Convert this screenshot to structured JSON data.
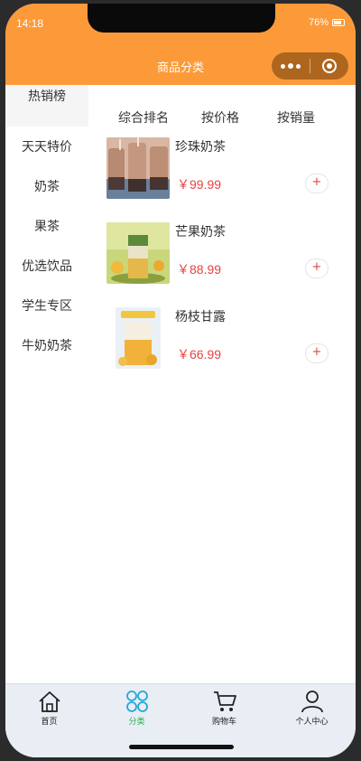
{
  "status": {
    "time": "14:18",
    "battery": "76%"
  },
  "nav": {
    "title": "商品分类"
  },
  "sidebar": {
    "items": [
      {
        "label": "热销榜",
        "active": true
      },
      {
        "label": "天天特价"
      },
      {
        "label": "奶茶"
      },
      {
        "label": "果茶"
      },
      {
        "label": "优选饮品"
      },
      {
        "label": "学生专区"
      },
      {
        "label": "牛奶奶茶"
      }
    ]
  },
  "sort": {
    "items": [
      "综合排名",
      "按价格",
      "按销量"
    ]
  },
  "products": [
    {
      "name": "珍珠奶茶",
      "price": "￥99.99",
      "add": "+"
    },
    {
      "name": "芒果奶茶",
      "price": "￥88.99",
      "add": "+"
    },
    {
      "name": "杨枝甘露",
      "price": "￥66.99",
      "add": "+"
    }
  ],
  "tabbar": {
    "items": [
      {
        "label": "首页",
        "icon": "home-icon"
      },
      {
        "label": "分类",
        "icon": "category-icon",
        "active": true
      },
      {
        "label": "购物车",
        "icon": "cart-icon"
      },
      {
        "label": "个人中心",
        "icon": "user-icon"
      }
    ]
  },
  "colors": {
    "brand": "#fc9a3a",
    "price": "#e64340",
    "active_tab": "#22b14c"
  }
}
